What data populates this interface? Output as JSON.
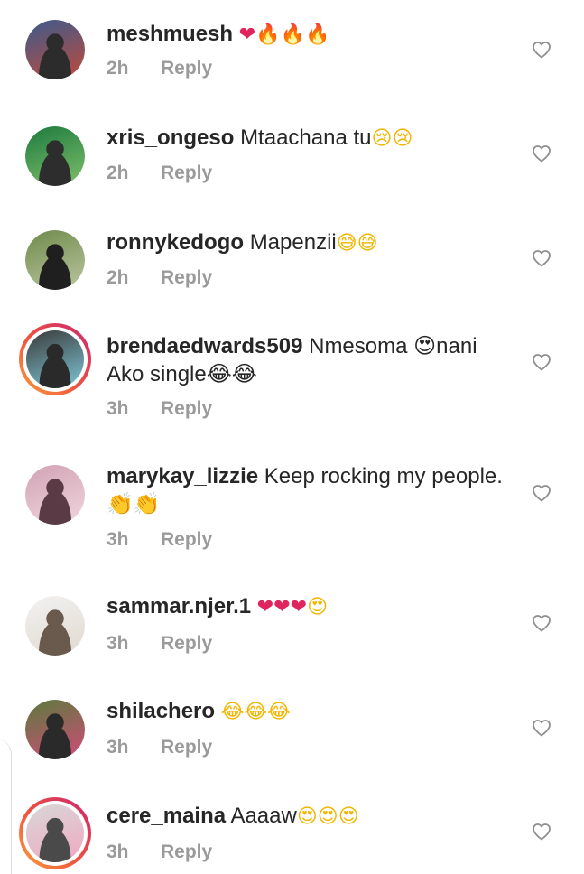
{
  "reply_label": "Reply",
  "colors": {
    "username": "#262626",
    "meta": "#9a9a9a",
    "heart": "#e0245e"
  },
  "comments": [
    {
      "username": "meshmuesh",
      "text": "",
      "emoji": [
        "❤",
        "🔥",
        "🔥",
        "🔥"
      ],
      "time": "2h",
      "avatar_story": false
    },
    {
      "username": "xris_ongeso",
      "text": "Mtaachana tu",
      "emoji": [
        "😢",
        "😢"
      ],
      "time": "2h",
      "avatar_story": false
    },
    {
      "username": "ronnykedogo",
      "text": "Mapenzii",
      "emoji": [
        "😅",
        "😅"
      ],
      "time": "2h",
      "avatar_story": false
    },
    {
      "username": "brendaedwards509",
      "text": "Nmesoma 😍nani Ako single😂😂",
      "emoji": [],
      "time": "3h",
      "avatar_story": true
    },
    {
      "username": "marykay_lizzie",
      "text": "Keep rocking my people.👏👏",
      "emoji": [],
      "time": "3h",
      "avatar_story": false
    },
    {
      "username": "sammar.njer.1",
      "text": "",
      "emoji": [
        "❤",
        "❤",
        "❤",
        "😍"
      ],
      "time": "3h",
      "avatar_story": false
    },
    {
      "username": "shilachero",
      "text": "",
      "emoji": [
        "😂",
        "😂",
        "😂"
      ],
      "time": "3h",
      "avatar_story": false
    },
    {
      "username": "cere_maina",
      "text": "Aaaaw",
      "emoji": [
        "😍",
        "😍",
        "😍"
      ],
      "time": "3h",
      "avatar_story": true
    }
  ]
}
